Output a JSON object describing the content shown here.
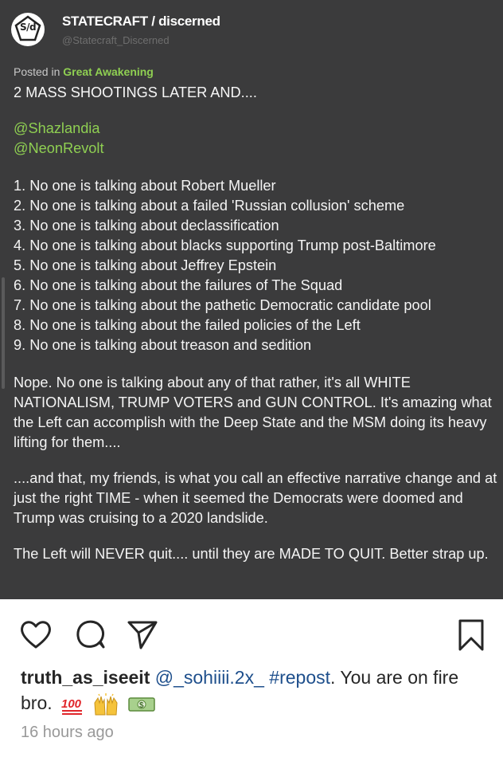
{
  "post": {
    "author_name": "STATECRAFT / discerned",
    "author_handle": "@Statecraft_Discerned",
    "logo_text": "S/d",
    "posted_in_prefix": "Posted in",
    "category": "Great Awakening",
    "headline": "2 MASS SHOOTINGS LATER AND....",
    "mentions": [
      "@Shazlandia",
      "@NeonRevolt"
    ],
    "list_items": [
      "1. No one is talking about Robert Mueller",
      "2. No one is talking about a failed 'Russian collusion' scheme",
      "3. No one is talking about declassification",
      "4. No one is talking about blacks supporting Trump post-Baltimore",
      "5. No one is talking about Jeffrey Epstein",
      "6. No one is talking about the failures of The Squad",
      "7. No one is talking about the pathetic Democratic candidate pool",
      "8. No one is talking about the failed policies of the Left",
      "9. No one is talking about treason and sedition"
    ],
    "paragraphs": [
      "Nope. No one is talking about any of that rather, it's all WHITE NATIONALISM, TRUMP VOTERS and GUN CONTROL. It's amazing what the Left can accomplish with the Deep State and the MSM doing its heavy lifting for them....",
      "....and that, my friends, is what you call an effective narrative change and at just the right TIME - when it seemed the Democrats were doomed and Trump was cruising to a 2020 landslide.",
      "The Left will NEVER quit.... until they are MADE TO QUIT. Better strap up."
    ]
  },
  "actions": {
    "icons": [
      "heart-icon",
      "comment-icon",
      "share-icon",
      "bookmark-icon"
    ]
  },
  "caption": {
    "username": "truth_as_iseeit",
    "mention": "@_sohiiii.2x_",
    "hashtag": "#repost",
    "text": ". You are on fire bro.",
    "emojis": [
      "100-emoji",
      "raised-hands-emoji",
      "money-emoji"
    ]
  },
  "timestamp": "16 hours ago",
  "colors": {
    "post_background": "#3b3b3c",
    "accent_green": "#8fcf52",
    "link_blue": "#1e4f8c"
  }
}
